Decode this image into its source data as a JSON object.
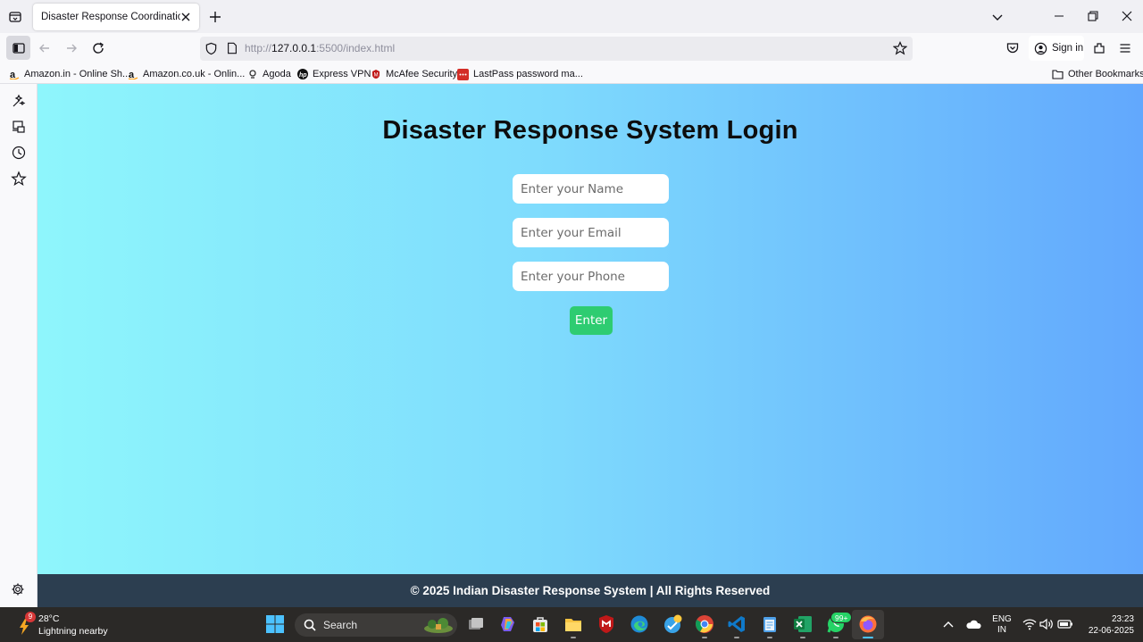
{
  "browser": {
    "tab_title": "Disaster Response Coordination Sys",
    "url_prefix": "http://",
    "url_host": "127.0.0.1",
    "url_rest": ":5500/index.html",
    "sign_in_label": "Sign in"
  },
  "bookmarks": [
    {
      "label": "Amazon.in - Online Sh...",
      "icon": "amazon-icon"
    },
    {
      "label": "Amazon.co.uk - Onlin...",
      "icon": "amazon-icon"
    },
    {
      "label": "Agoda",
      "icon": "agoda-icon"
    },
    {
      "label": "Express VPN",
      "icon": "hp-icon"
    },
    {
      "label": "McAfee Security",
      "icon": "mcafee-icon"
    },
    {
      "label": "LastPass password ma...",
      "icon": "lastpass-icon"
    }
  ],
  "other_bookmarks_label": "Other Bookmarks",
  "page": {
    "title": "Disaster Response System Login",
    "name_placeholder": "Enter your Name",
    "email_placeholder": "Enter your Email",
    "phone_placeholder": "Enter your Phone",
    "enter_label": "Enter",
    "footer_text": "© 2025 Indian Disaster Response System | All Rights Reserved"
  },
  "colors": {
    "gradient_start": "#8ef6fc",
    "gradient_end": "#62a8fd",
    "button_green": "#2ecc71",
    "footer_bg": "#2c3e50"
  },
  "taskbar": {
    "weather_badge": "9",
    "weather_temp": "28°C",
    "weather_desc": "Lightning nearby",
    "search_label": "Search",
    "whatsapp_badge": "99+",
    "lang_line1": "ENG",
    "lang_line2": "IN",
    "time": "23:23",
    "date": "22-06-2025"
  }
}
